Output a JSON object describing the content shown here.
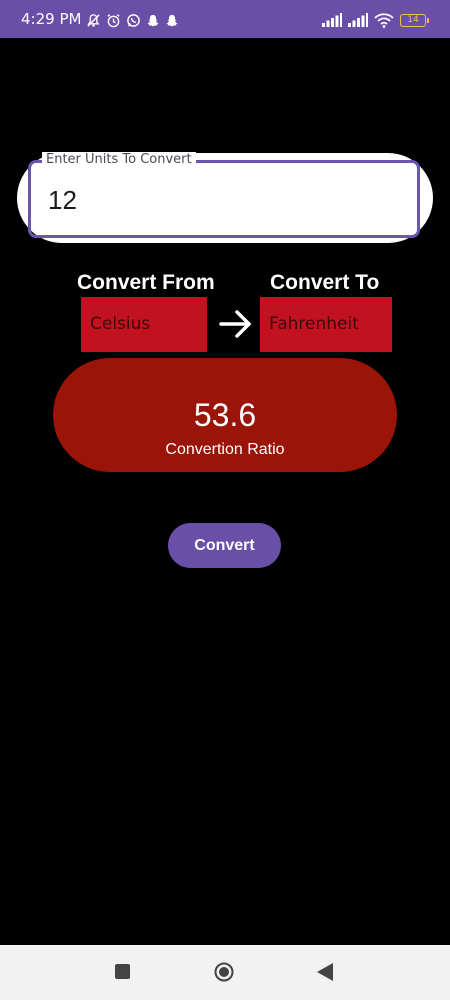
{
  "status_bar": {
    "time": "4:29 PM",
    "battery_level": "14",
    "icons_left": [
      "mute-icon",
      "alarm-icon",
      "whatsapp-icon",
      "snapchat-icon",
      "snapchat-icon"
    ],
    "icons_right": [
      "signal-icon",
      "signal-icon",
      "wifi-icon",
      "battery-icon"
    ],
    "color": "#6a4fa8"
  },
  "input": {
    "label": "Enter Units To Convert",
    "value": "12"
  },
  "converter": {
    "from_label": "Convert From",
    "to_label": "Convert To",
    "from_unit": "Celsius",
    "to_unit": "Fahrenheit",
    "arrow_icon": "arrow-right-icon",
    "select_color": "#c2121f"
  },
  "result": {
    "value": "53.6",
    "caption": "Convertion Ratio",
    "color": "#9a1408"
  },
  "actions": {
    "convert_label": "Convert",
    "button_color": "#6a4fa8"
  },
  "nav": {
    "icons": [
      "recent-apps-icon",
      "home-icon",
      "back-icon"
    ]
  }
}
